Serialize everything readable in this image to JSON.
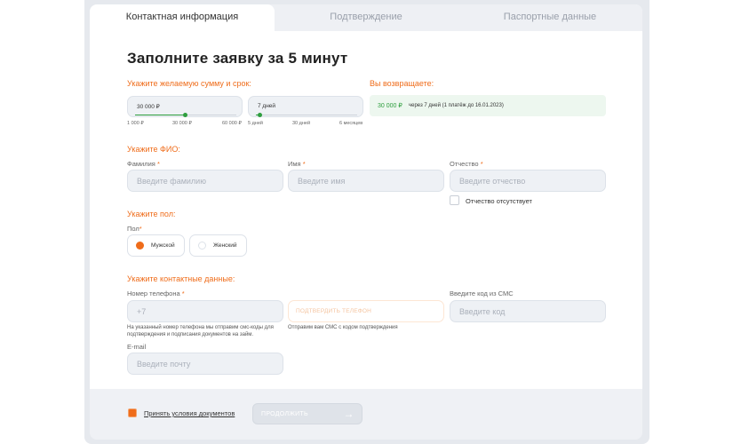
{
  "tabs": [
    {
      "label": "Контактная информация",
      "active": true
    },
    {
      "label": "Подтверждение",
      "active": false
    },
    {
      "label": "Паспортные данные",
      "active": false
    }
  ],
  "title": "Заполните заявку за 5 минут",
  "loan": {
    "section_label": "Укажите желаемую сумму и срок:",
    "amount": {
      "value": "30 000 ₽",
      "ticks": [
        "1 000 ₽",
        "30 000 ₽",
        "60 000 ₽"
      ]
    },
    "term": {
      "value": "7 дней",
      "ticks": [
        "5 дней",
        "30 дней",
        "6 месяцев"
      ]
    }
  },
  "repay": {
    "section_label": "Вы возвращаете:",
    "amount": "30 000 ₽",
    "details": "через 7 дней (1 платёж до 16.01.2023)"
  },
  "name": {
    "section_label": "Укажите ФИО:",
    "surname_label": "Фамилия",
    "surname_placeholder": "Введите фамилию",
    "first_label": "Имя",
    "first_placeholder": "Введите имя",
    "patronymic_label": "Отчество",
    "patronymic_placeholder": "Введите отчество",
    "no_patronymic_label": "Отчество отсутствует",
    "required_mark": "*"
  },
  "gender": {
    "section_label": "Укажите пол:",
    "field_label": "Пол",
    "male": "Мужской",
    "female": "Женский"
  },
  "contacts": {
    "section_label": "Укажите контактные данные:",
    "phone_label": "Номер телефона",
    "phone_placeholder": "+7",
    "phone_hint": "На указанный номер телефона мы отправим смс-коды для подтверждения и подписания документов на займ.",
    "confirm_phone_label": "ПОДТВЕРДИТЬ ТЕЛЕФОН",
    "sms_hint": "Отправим вам СМС с кодом подтверждения",
    "sms_label": "Введите код из СМС",
    "sms_placeholder": "Введите код",
    "email_label": "E-mail",
    "email_placeholder": "Введите почту"
  },
  "footer": {
    "agree_label": "Принять условия документов",
    "continue_label": "ПРОДОЛЖИТЬ",
    "arrow_icon": "arrow-right-icon"
  },
  "colors": {
    "accent": "#ef6c1a",
    "green": "#2e9e3e"
  }
}
